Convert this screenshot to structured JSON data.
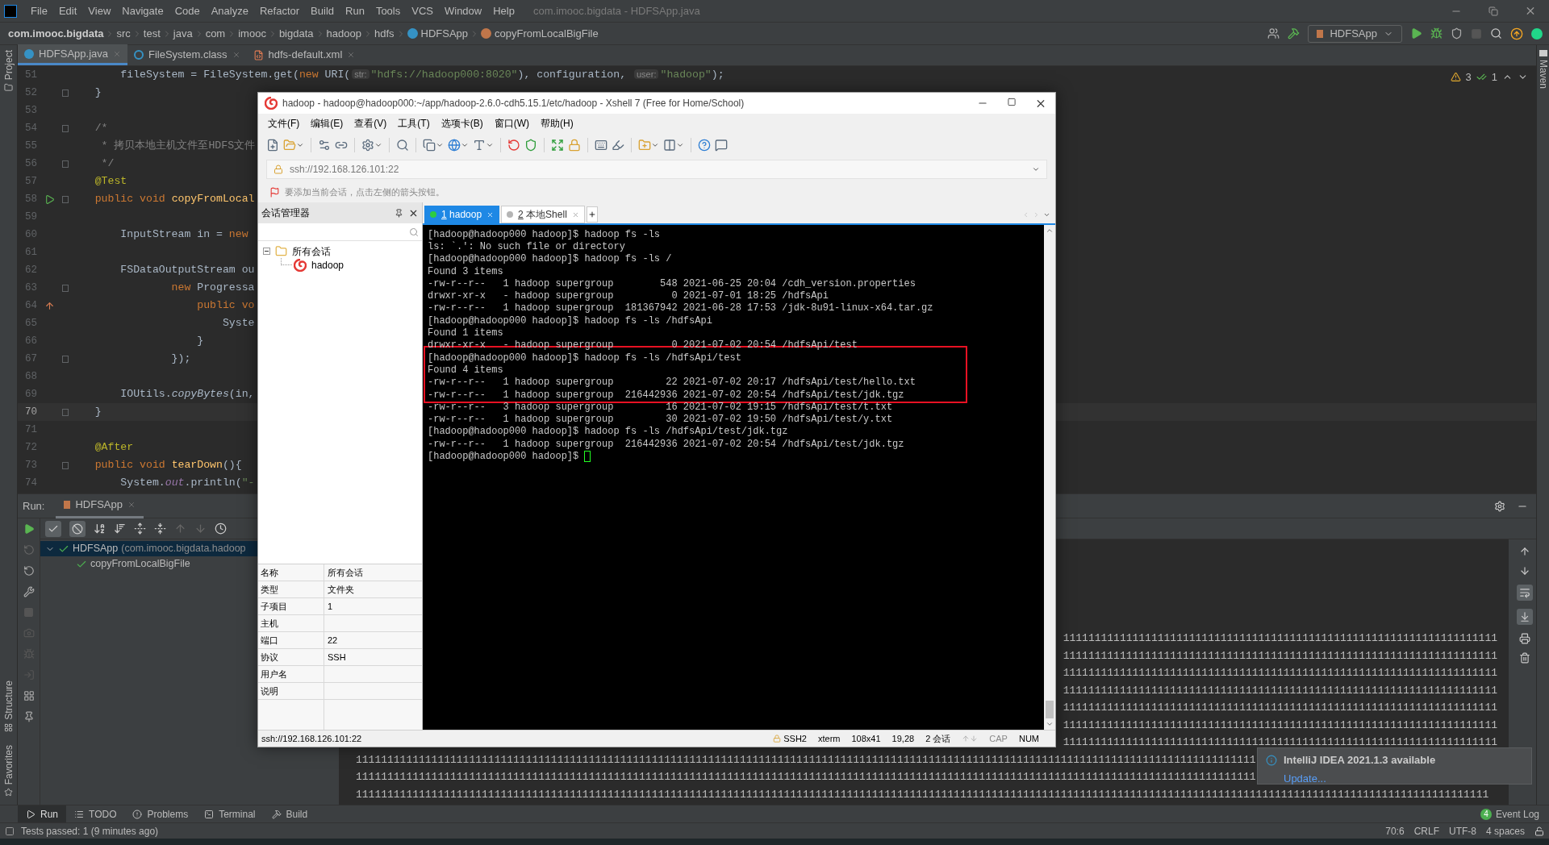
{
  "ide": {
    "title": "com.imooc.bigdata - HDFSApp.java",
    "menu": [
      "File",
      "Edit",
      "View",
      "Navigate",
      "Code",
      "Analyze",
      "Refactor",
      "Build",
      "Run",
      "Tools",
      "VCS",
      "Window",
      "Help"
    ],
    "breadcrumbs": [
      {
        "label": "com.imooc.bigdata",
        "kind": "project"
      },
      {
        "label": "src",
        "kind": "folder"
      },
      {
        "label": "test",
        "kind": "folder"
      },
      {
        "label": "java",
        "kind": "folder"
      },
      {
        "label": "com",
        "kind": "folder"
      },
      {
        "label": "imooc",
        "kind": "folder"
      },
      {
        "label": "bigdata",
        "kind": "folder"
      },
      {
        "label": "hadoop",
        "kind": "folder"
      },
      {
        "label": "hdfs",
        "kind": "folder"
      },
      {
        "label": "HDFSApp",
        "kind": "class"
      },
      {
        "label": "copyFromLocalBigFile",
        "kind": "method"
      }
    ],
    "run_config": "HDFSApp",
    "editor_tabs": [
      {
        "label": "HDFSApp.java",
        "kind": "java",
        "selected": true
      },
      {
        "label": "FileSystem.class",
        "kind": "class",
        "selected": false
      },
      {
        "label": "hdfs-default.xml",
        "kind": "xml",
        "selected": false
      }
    ],
    "inspections": {
      "warnings": "3",
      "passed": "1"
    },
    "side_tools": {
      "top": "Project",
      "bottom": [
        "Structure",
        "Favorites"
      ],
      "right": "Maven"
    },
    "code_lines": [
      {
        "number": "51",
        "current": false,
        "fold": false,
        "tokens": [
          {
            "kind": "plain",
            "text": "        fileSystem = FileSystem.get("
          },
          {
            "kind": "keyword",
            "text": "new"
          },
          {
            "kind": "plain",
            "text": " URI("
          },
          {
            "kind": "hint",
            "text": "str:"
          },
          {
            "kind": "string",
            "text": "\"hdfs://hadoop000:8020\""
          },
          {
            "kind": "plain",
            "text": "), configuration, "
          },
          {
            "kind": "hint",
            "text": "user:"
          },
          {
            "kind": "string",
            "text": "\"hadoop\""
          },
          {
            "kind": "plain",
            "text": ");"
          }
        ]
      },
      {
        "number": "52",
        "current": false,
        "fold": true,
        "tokens": [
          {
            "kind": "plain",
            "text": "    }"
          }
        ]
      },
      {
        "number": "53",
        "current": false,
        "fold": false
      },
      {
        "number": "54",
        "current": false,
        "fold": true,
        "tokens": [
          {
            "kind": "comment",
            "text": "    /*"
          }
        ]
      },
      {
        "number": "55",
        "current": false,
        "fold": false,
        "tokens": [
          {
            "kind": "comment",
            "text": "     * 拷贝本地主机文件至HDFS文件"
          }
        ]
      },
      {
        "number": "56",
        "current": false,
        "fold": true,
        "tokens": [
          {
            "kind": "comment",
            "text": "     */"
          }
        ]
      },
      {
        "number": "57",
        "current": false,
        "fold": false,
        "tokens": [
          {
            "kind": "annotation",
            "text": "    @Test"
          }
        ]
      },
      {
        "number": "58",
        "current": false,
        "fold": true,
        "kind": "run",
        "tokens": [
          {
            "kind": "keyword",
            "text": "    public void "
          },
          {
            "kind": "method",
            "text": "copyFromLocal"
          }
        ]
      },
      {
        "number": "59",
        "current": false,
        "fold": false
      },
      {
        "number": "60",
        "current": false,
        "fold": false,
        "tokens": [
          {
            "kind": "plain",
            "text": "        InputStream in = "
          },
          {
            "kind": "keyword",
            "text": "new"
          }
        ]
      },
      {
        "number": "61",
        "current": false,
        "fold": false
      },
      {
        "number": "62",
        "current": false,
        "fold": false,
        "tokens": [
          {
            "kind": "plain",
            "text": "        FSDataOutputStream ou"
          }
        ]
      },
      {
        "number": "63",
        "current": false,
        "fold": true,
        "tokens": [
          {
            "kind": "keyword",
            "text": "                new"
          },
          {
            "kind": "plain",
            "text": " Progressa"
          }
        ]
      },
      {
        "number": "64",
        "current": false,
        "fold": false,
        "kind": "override",
        "tokens": [
          {
            "kind": "keyword",
            "text": "                    public vo"
          }
        ]
      },
      {
        "number": "65",
        "current": false,
        "fold": false,
        "tokens": [
          {
            "kind": "plain",
            "text": "                        Syste"
          }
        ]
      },
      {
        "number": "66",
        "current": false,
        "fold": false,
        "tokens": [
          {
            "kind": "plain",
            "text": "                    }"
          }
        ]
      },
      {
        "number": "67",
        "current": false,
        "fold": true,
        "tokens": [
          {
            "kind": "plain",
            "text": "                });"
          }
        ]
      },
      {
        "number": "68",
        "current": false,
        "fold": false
      },
      {
        "number": "69",
        "current": false,
        "fold": false,
        "tokens": [
          {
            "kind": "plain",
            "text": "        IOUtils."
          },
          {
            "kind": "italic",
            "text": "copyBytes"
          },
          {
            "kind": "plain",
            "text": "(in,"
          }
        ]
      },
      {
        "number": "70",
        "current": true,
        "fold": true,
        "tokens": [
          {
            "kind": "plain",
            "text": "    }"
          }
        ]
      },
      {
        "number": "71",
        "current": false,
        "fold": false
      },
      {
        "number": "72",
        "current": false,
        "fold": false,
        "tokens": [
          {
            "kind": "annotation",
            "text": "    @After"
          }
        ]
      },
      {
        "number": "73",
        "current": false,
        "fold": true,
        "tokens": [
          {
            "kind": "keyword",
            "text": "    public void "
          },
          {
            "kind": "method",
            "text": "tearDown"
          },
          {
            "kind": "plain",
            "text": "(){"
          }
        ]
      },
      {
        "number": "74",
        "current": false,
        "fold": false,
        "tokens": [
          {
            "kind": "plain",
            "text": "        System."
          },
          {
            "kind": "static",
            "text": "out"
          },
          {
            "kind": "plain",
            "text": ".println("
          },
          {
            "kind": "string",
            "text": "\"-"
          }
        ]
      }
    ],
    "run_panel": {
      "label": "Run:",
      "tab": "HDFSApp",
      "tree": [
        {
          "label": "HDFSApp",
          "detail": "(com.imooc.bigdata.hadoop",
          "passed": true,
          "selected": true,
          "expanded": true,
          "children": [
            {
              "label": "copyFromLocalBigFile",
              "passed": true,
              "selected": false
            }
          ]
        }
      ],
      "console_rows": [
        {
          "kind": "tail",
          "text": "111111111111111111111111111111111111111111111111111111111111111111111"
        },
        {
          "kind": "tail",
          "text": "111111111111111111111111111111111111111111111111111111111111111111111"
        },
        {
          "kind": "tail",
          "text": "111111111111111111111111111111111111111111111111111111111111111111111"
        },
        {
          "kind": "tail",
          "text": "111111111111111111111111111111111111111111111111111111111111111111111"
        },
        {
          "kind": "tail",
          "text": "111111111111111111111111111111111111111111111111111111111111111111111"
        },
        {
          "kind": "tail",
          "text": "111111111111111111111111111111111111111111111111111111111111111111111"
        },
        {
          "kind": "tail",
          "text": "111111111111111111111111111111111111111111111111111111111111111111111"
        },
        {
          "kind": "head",
          "text": "11111111111111111111111111111111111111111111111111111111111111111111111111111111111111111111111111111111111111111111111111111111111111111111111"
        },
        {
          "kind": "head",
          "text": "11111111111111111111111111111111111111111111111111111111111111111111111111111111111111111111111111111111111111111111111111111111111111111111111"
        },
        {
          "kind": "full",
          "text": "111111111111111111111111111111111111111111111111111111111111111111111111111111111111111111111111111111111111111111111111111111111111111111111111111111111111111111111111111111111111"
        }
      ]
    },
    "tool_tabs": [
      {
        "label": "Run",
        "kind": "run",
        "selected": true
      },
      {
        "label": "TODO",
        "kind": "todo",
        "selected": false
      },
      {
        "label": "Problems",
        "kind": "problems",
        "selected": false
      },
      {
        "label": "Terminal",
        "kind": "terminal",
        "selected": false
      },
      {
        "label": "Build",
        "kind": "build",
        "selected": false
      }
    ],
    "event_log": {
      "label": "Event Log",
      "count": "4"
    },
    "status_bar": {
      "message": "Tests passed: 1 (9 minutes ago)",
      "position": "70:6",
      "line_separator": "CRLF",
      "encoding": "UTF-8",
      "indent": "4 spaces"
    },
    "notification": {
      "title": "IntelliJ IDEA 2021.1.3 available",
      "link": "Update..."
    }
  },
  "xshell": {
    "title": "hadoop - hadoop@hadoop000:~/app/hadoop-2.6.0-cdh5.15.1/etc/hadoop - Xshell 7 (Free for Home/School)",
    "menu": [
      "文件(F)",
      "编辑(E)",
      "查看(V)",
      "工具(T)",
      "选项卡(B)",
      "窗口(W)",
      "帮助(H)"
    ],
    "address": "ssh://192.168.126.101:22",
    "hint": "要添加当前会话，点击左侧的箭头按钮。",
    "session_manager": {
      "title": "会话管理器",
      "tree": [
        {
          "label": "所有会话",
          "expanded": true,
          "children": [
            {
              "label": "hadoop"
            }
          ]
        }
      ],
      "properties": [
        {
          "name": "名称",
          "value": "所有会话"
        },
        {
          "name": "类型",
          "value": "文件夹"
        },
        {
          "name": "子项目",
          "value": "1"
        },
        {
          "name": "主机"
        },
        {
          "name": "端口",
          "value": "22"
        },
        {
          "name": "协议",
          "value": "SSH"
        },
        {
          "name": "用户名"
        },
        {
          "name": "说明"
        }
      ]
    },
    "tabs": [
      {
        "number": "1",
        "label": "hadoop",
        "selected": true,
        "connected": true
      },
      {
        "number": "2",
        "label": "本地Shell",
        "selected": false,
        "connected": false
      }
    ],
    "terminal": [
      {
        "text": "[hadoop@hadoop000 hadoop]$ hadoop fs -ls",
        "highlighted": false
      },
      {
        "text": "ls: `.': No such file or directory",
        "highlighted": false
      },
      {
        "text": "[hadoop@hadoop000 hadoop]$ hadoop fs -ls /",
        "highlighted": false
      },
      {
        "text": "Found 3 items",
        "highlighted": false
      },
      {
        "text": "-rw-r--r--   1 hadoop supergroup        548 2021-06-25 20:04 /cdh_version.properties",
        "highlighted": false
      },
      {
        "text": "drwxr-xr-x   - hadoop supergroup          0 2021-07-01 18:25 /hdfsApi",
        "highlighted": false
      },
      {
        "text": "-rw-r--r--   1 hadoop supergroup  181367942 2021-06-28 17:53 /jdk-8u91-linux-x64.tar.gz",
        "highlighted": false
      },
      {
        "text": "[hadoop@hadoop000 hadoop]$ hadoop fs -ls /hdfsApi",
        "highlighted": false
      },
      {
        "text": "Found 1 items",
        "highlighted": false
      },
      {
        "text": "drwxr-xr-x   - hadoop supergroup          0 2021-07-02 20:54 /hdfsApi/test",
        "highlighted": false
      },
      {
        "text": "[hadoop@hadoop000 hadoop]$ hadoop fs -ls /hdfsApi/test",
        "highlighted": true
      },
      {
        "text": "Found 4 items",
        "highlighted": true
      },
      {
        "text": "-rw-r--r--   1 hadoop supergroup         22 2021-07-02 20:17 /hdfsApi/test/hello.txt",
        "highlighted": true
      },
      {
        "text": "-rw-r--r--   1 hadoop supergroup  216442936 2021-07-02 20:54 /hdfsApi/test/jdk.tgz",
        "highlighted": true
      },
      {
        "text": "-rw-r--r--   3 hadoop supergroup         16 2021-07-02 19:15 /hdfsApi/test/t.txt",
        "highlighted": false
      },
      {
        "text": "-rw-r--r--   1 hadoop supergroup         30 2021-07-02 19:50 /hdfsApi/test/y.txt",
        "highlighted": false
      },
      {
        "text": "[hadoop@hadoop000 hadoop]$ hadoop fs -ls /hdfsApi/test/jdk.tgz",
        "highlighted": false
      },
      {
        "text": "-rw-r--r--   1 hadoop supergroup  216442936 2021-07-02 20:54 /hdfsApi/test/jdk.tgz",
        "highlighted": false
      },
      {
        "text": "[hadoop@hadoop000 hadoop]$ ",
        "highlighted": false,
        "cursor": true
      }
    ],
    "status_bar": {
      "address": "ssh://192.168.126.101:22",
      "protocol": "SSH2",
      "terminal": "xterm",
      "size": "108x41",
      "cursor": "19,28",
      "sessions": "2 会话",
      "caps": "CAP",
      "num": "NUM"
    }
  }
}
